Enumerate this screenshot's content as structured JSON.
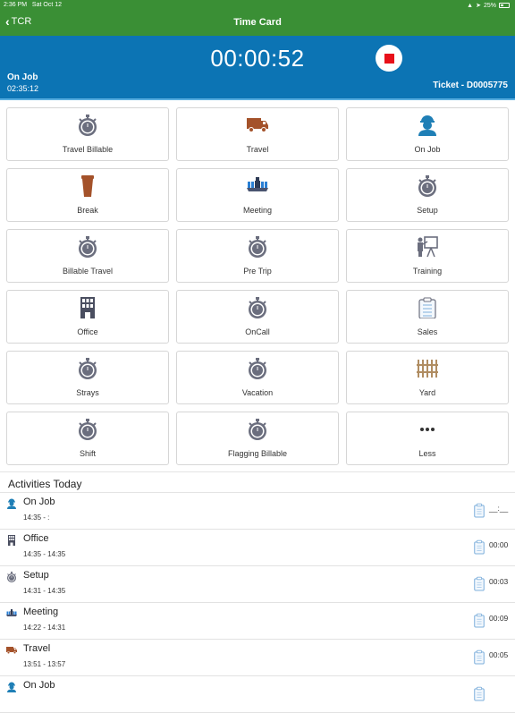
{
  "status_bar": {
    "time": "2:36 PM",
    "date": "Sat Oct 12",
    "battery": "25%"
  },
  "nav": {
    "back_label": "TCR",
    "title": "Time Card"
  },
  "timer": {
    "elapsed": "00:00:52",
    "current_activity": "On Job",
    "current_activity_time": "02:35:12",
    "ticket": "Ticket - D0005775"
  },
  "activities": [
    {
      "label": "Travel Billable",
      "icon": "stopwatch-icon"
    },
    {
      "label": "Travel",
      "icon": "truck-icon"
    },
    {
      "label": "On Job",
      "icon": "worker-icon"
    },
    {
      "label": "Break",
      "icon": "coffee-cup-icon"
    },
    {
      "label": "Meeting",
      "icon": "meeting-icon"
    },
    {
      "label": "Setup",
      "icon": "stopwatch-icon"
    },
    {
      "label": "Billable Travel",
      "icon": "stopwatch-icon"
    },
    {
      "label": "Pre Trip",
      "icon": "stopwatch-icon"
    },
    {
      "label": "Training",
      "icon": "training-icon"
    },
    {
      "label": "Office",
      "icon": "building-icon"
    },
    {
      "label": "OnCall",
      "icon": "stopwatch-icon"
    },
    {
      "label": "Sales",
      "icon": "clipboard-icon"
    },
    {
      "label": "Strays",
      "icon": "stopwatch-icon"
    },
    {
      "label": "Vacation",
      "icon": "stopwatch-icon"
    },
    {
      "label": "Yard",
      "icon": "fence-icon"
    },
    {
      "label": "Shift",
      "icon": "stopwatch-icon"
    },
    {
      "label": "Flagging Billable",
      "icon": "stopwatch-icon"
    },
    {
      "label": "Less",
      "icon": "more-dots-icon"
    }
  ],
  "activities_today": {
    "header": "Activities Today",
    "items": [
      {
        "name": "On Job",
        "range": "14:35 - :",
        "duration": "__:__",
        "icon": "worker-icon"
      },
      {
        "name": "Office",
        "range": "14:35 - 14:35",
        "duration": "00:00",
        "icon": "building-icon"
      },
      {
        "name": "Setup",
        "range": "14:31 - 14:35",
        "duration": "00:03",
        "icon": "stopwatch-icon"
      },
      {
        "name": "Meeting",
        "range": "14:22 - 14:31",
        "duration": "00:09",
        "icon": "meeting-icon"
      },
      {
        "name": "Travel",
        "range": "13:51 - 13:57",
        "duration": "00:05",
        "icon": "truck-icon"
      },
      {
        "name": "On Job",
        "range": "",
        "duration": "",
        "icon": "worker-icon"
      }
    ]
  },
  "colors": {
    "nav_green": "#3a8f35",
    "timer_blue": "#0c74b4",
    "stop_red": "#e8101a",
    "icon_gray": "#6b6e7e",
    "brown": "#a4522a",
    "worker_blue": "#1f7fb6"
  }
}
